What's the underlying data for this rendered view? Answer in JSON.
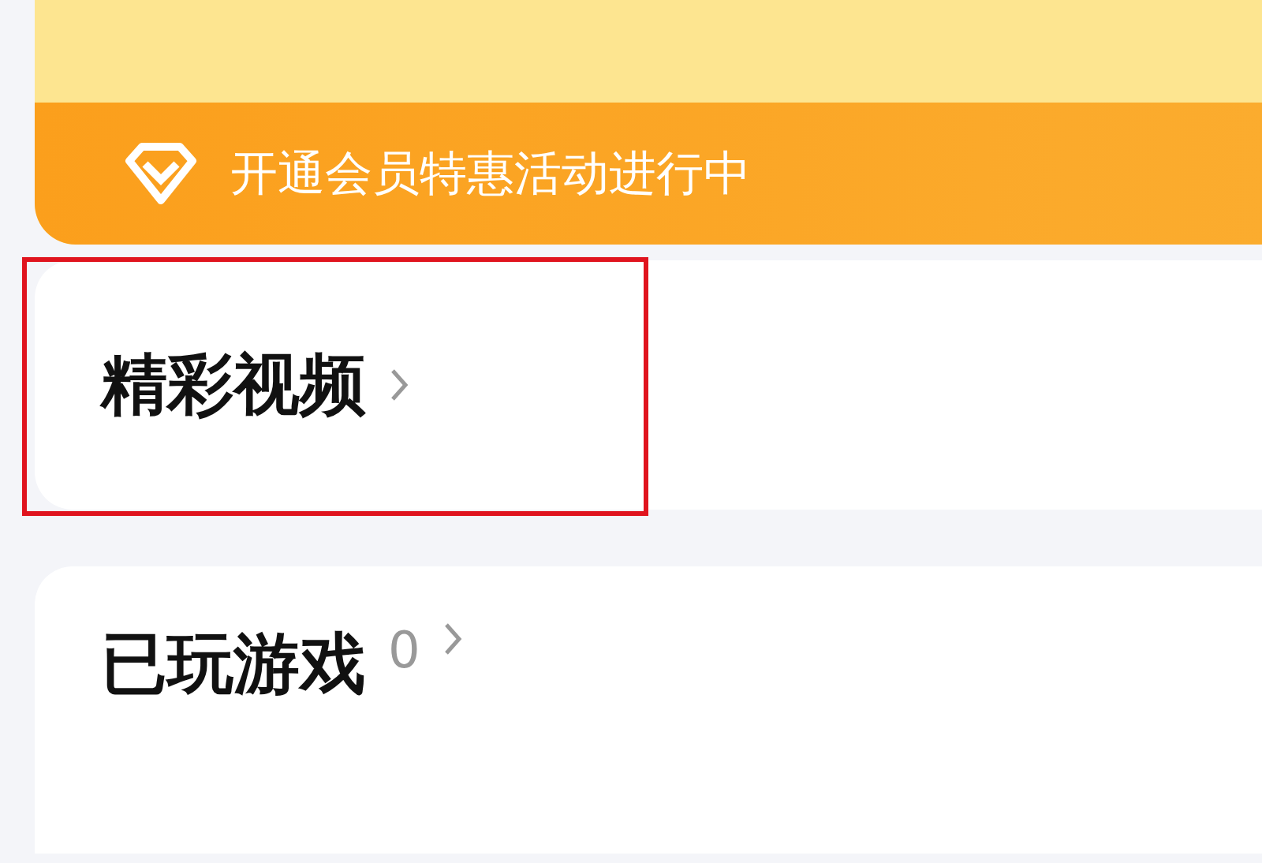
{
  "vip_banner": {
    "text": "开通会员特惠活动进行中"
  },
  "sections": [
    {
      "title": "精彩视频",
      "highlighted": true
    },
    {
      "title": "已玩游戏",
      "count": "0",
      "highlighted": false
    }
  ]
}
